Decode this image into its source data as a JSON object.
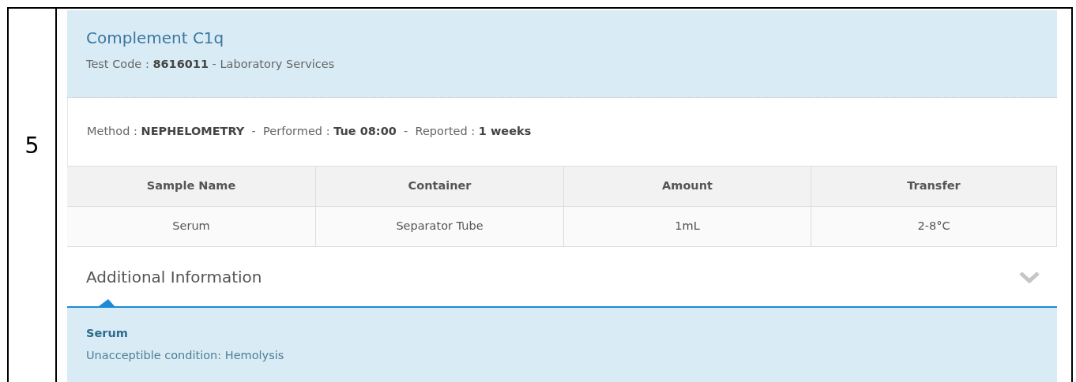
{
  "row_number": "5",
  "test": {
    "title": "Complement C1q",
    "subtitle": "Test Code : **8616011** - Laboratory Services"
  },
  "meta": "Method : **NEPHELOMETRY**  -  Performed : **Tue 08:00**  -  Reported : **1 weeks**",
  "table": {
    "columns": [
      "Sample Name",
      "Container",
      "Amount",
      "Transfer"
    ],
    "rows": [
      [
        "Serum",
        "Separator Tube",
        "1mL",
        "2-8°C"
      ]
    ]
  },
  "additional_info": {
    "title": "Additional Information",
    "items": [
      {
        "heading": "Serum",
        "text": "Unacceptible condition: Hemolysis"
      }
    ]
  }
}
